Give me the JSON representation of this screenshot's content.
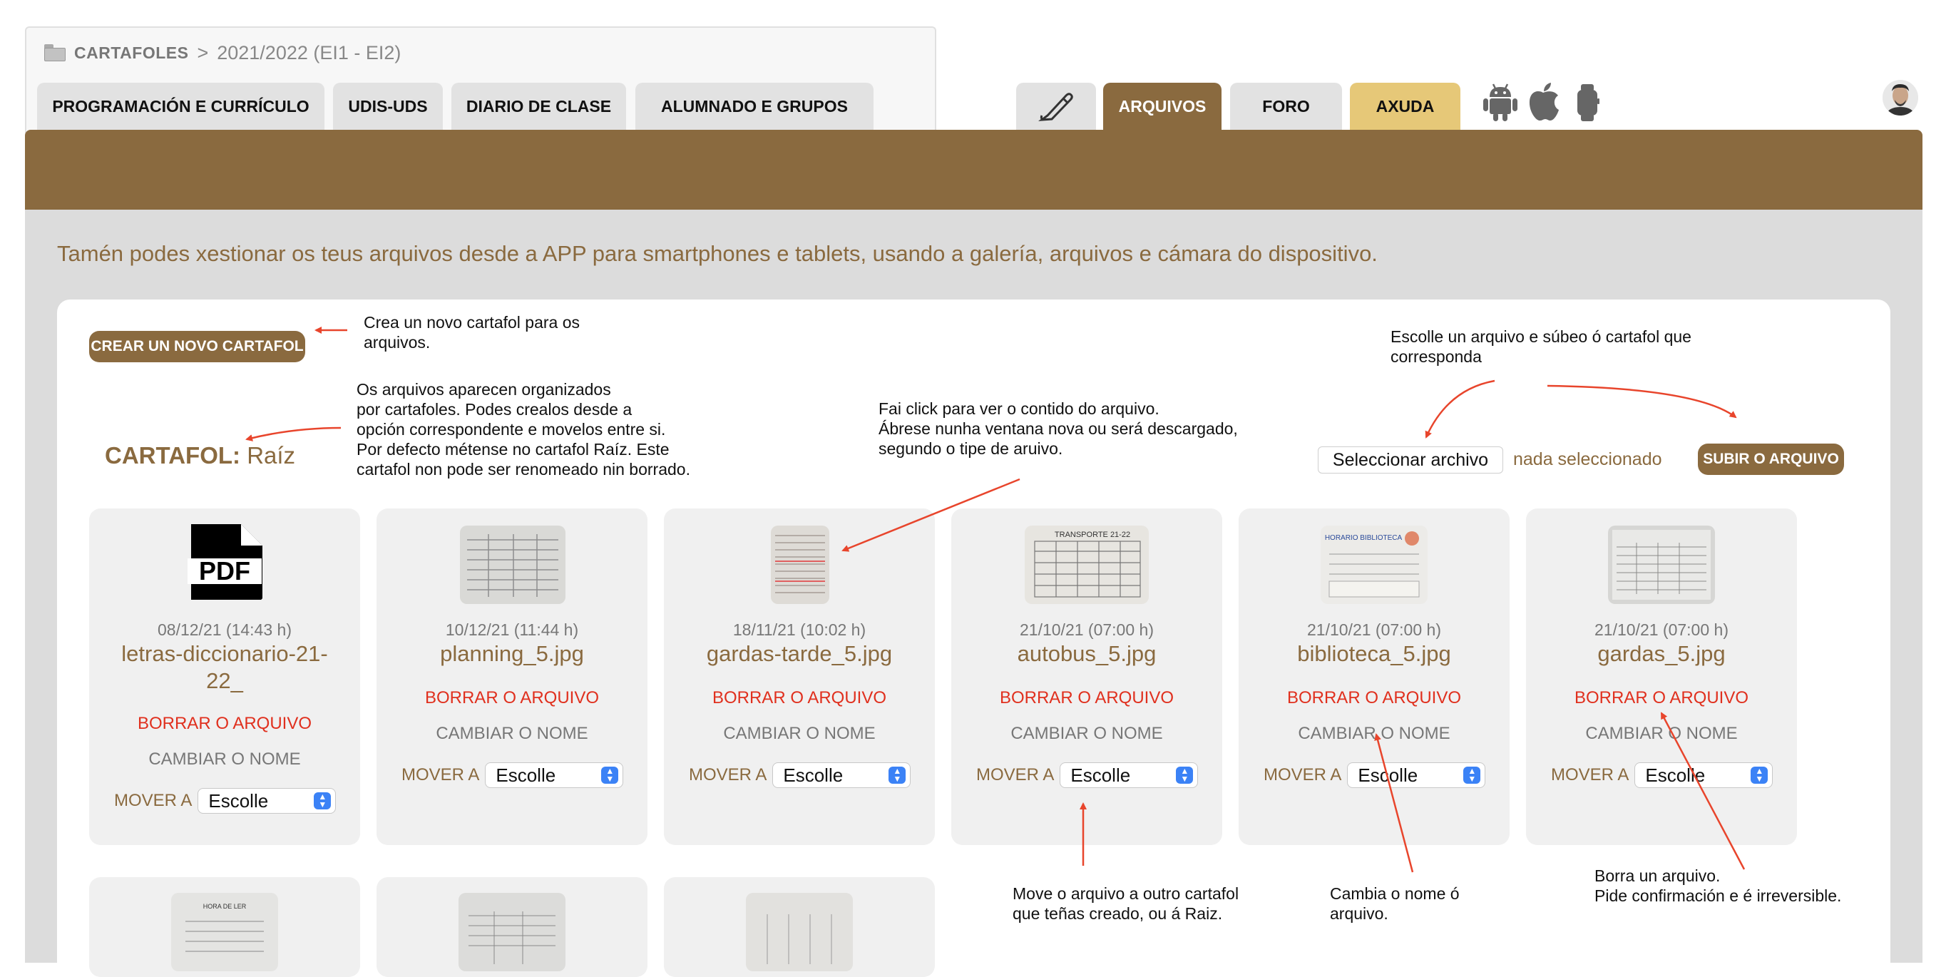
{
  "breadcrumb": {
    "root": "CARTAFOLES",
    "separator": ">",
    "current": "2021/2022 (EI1 - EI2)"
  },
  "tabs": {
    "programacion": "PROGRAMACIÓN E CURRÍCULO",
    "udis": "UDIS-UDS",
    "diario": "DIARIO DE CLASE",
    "alumnado": "ALUMNADO E GRUPOS",
    "arquivos": "ARQUIVOS",
    "foro": "FORO",
    "axuda": "AXUDA"
  },
  "info_text": "Tamén podes xestionar os teus arquivos desde a APP para smartphones e tablets, usando a galería, arquivos e cámara do dispositivo.",
  "create_button": "CREAR UN NOVO CARTAFOL",
  "cartafol": {
    "label": "CARTAFOL:",
    "name": "Raíz"
  },
  "upload": {
    "select_button": "Seleccionar archivo",
    "no_file": "nada seleccionado",
    "submit": "SUBIR O ARQUIVO"
  },
  "annotations": {
    "create": "Crea un novo cartafol para os\narquivos.",
    "folders": "Os arquivos aparecen organizados\npor cartafoles. Podes crealos desde a\nopción correspondente e movelos entre si.\nPor defecto métense no cartafol Raíz. Este\ncartafol non pode ser renomeado nin borrado.",
    "click": "Fai click para ver o contido do arquivo.\nÁbrese nunha ventana nova ou será descargado,\nsegundo o tipe de aruivo.",
    "upload": "Escolle un arquivo e súbeo ó cartafol  que\ncorresponda",
    "move": "Move o arquivo a outro cartafol\nque teñas creado, ou á Raiz.",
    "rename": "Cambia o nome ó\narquivo.",
    "delete": "Borra un arquivo.\nPide confirmación e é irreversible."
  },
  "file_actions": {
    "delete": "BORRAR O ARQUIVO",
    "rename": "CAMBIAR O NOME",
    "move_label": "MOVER A",
    "move_default": "Escolle"
  },
  "files": [
    {
      "date": "08/12/21 (14:43 h)",
      "name": "letras-diccionario-21-22_",
      "icon": "pdf-icon"
    },
    {
      "date": "10/12/21 (11:44 h)",
      "name": "planning_5.jpg",
      "icon": "photo-thumbnail"
    },
    {
      "date": "18/11/21 (10:02 h)",
      "name": "gardas-tarde_5.jpg",
      "icon": "photo-thumbnail"
    },
    {
      "date": "21/10/21 (07:00 h)",
      "name": "autobus_5.jpg",
      "icon": "photo-thumbnail",
      "thumb_text": "TRANSPORTE 21-22"
    },
    {
      "date": "21/10/21 (07:00 h)",
      "name": "biblioteca_5.jpg",
      "icon": "photo-thumbnail",
      "thumb_text": "HORARIO BIBLIOTECA"
    },
    {
      "date": "21/10/21 (07:00 h)",
      "name": "gardas_5.jpg",
      "icon": "photo-thumbnail"
    }
  ],
  "files_row2": [
    {
      "icon": "photo-thumbnail",
      "thumb_text": "HORA DE LER"
    },
    {
      "icon": "photo-thumbnail"
    },
    {
      "icon": "photo-thumbnail"
    }
  ],
  "colors": {
    "brand_brown": "#8a6a3f",
    "delete_red": "#e0301e",
    "help_yellow": "#e6c878",
    "annotation_arrow": "#e8452c"
  },
  "platform_icons": [
    "android-icon",
    "apple-icon",
    "smartwatch-icon"
  ]
}
